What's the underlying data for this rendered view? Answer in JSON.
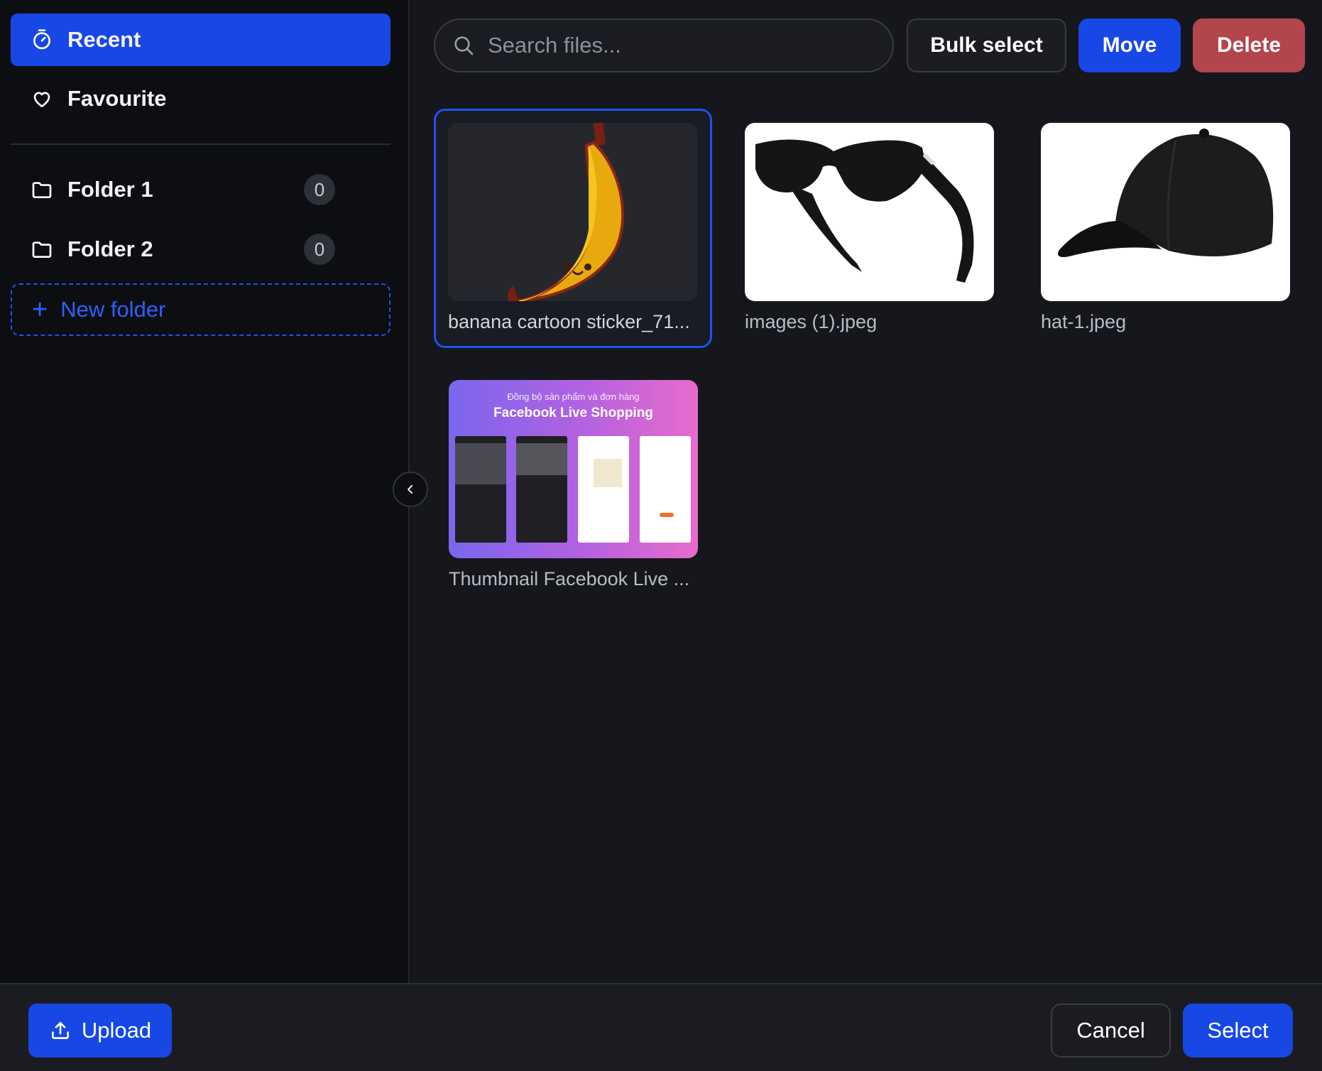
{
  "sidebar": {
    "nav": [
      {
        "label": "Recent",
        "icon": "timer-icon",
        "active": true
      },
      {
        "label": "Favourite",
        "icon": "heart-icon",
        "active": false
      }
    ],
    "folders": [
      {
        "label": "Folder 1",
        "count": "0"
      },
      {
        "label": "Folder 2",
        "count": "0"
      }
    ],
    "new_folder_label": "New folder"
  },
  "toolbar": {
    "search_placeholder": "Search files...",
    "bulk_select_label": "Bulk select",
    "move_label": "Move",
    "delete_label": "Delete"
  },
  "files": [
    {
      "name": "banana cartoon sticker_71...",
      "thumbnail": "banana-cartoon",
      "selected": true
    },
    {
      "name": "images (1).jpeg",
      "thumbnail": "black-sunglasses",
      "selected": false
    },
    {
      "name": "hat-1.jpeg",
      "thumbnail": "black-cap",
      "selected": false
    },
    {
      "name": "Thumbnail Facebook Live ...",
      "thumbnail": "facebook-live-banner",
      "selected": false,
      "thumb_text": {
        "line1": "Đồng bộ sản phẩm và đơn hàng",
        "line2": "Facebook Live Shopping"
      }
    }
  ],
  "footer": {
    "upload_label": "Upload",
    "cancel_label": "Cancel",
    "select_label": "Select"
  },
  "colors": {
    "accent": "#1747e5",
    "danger": "#b3454c",
    "background": "#111217"
  }
}
